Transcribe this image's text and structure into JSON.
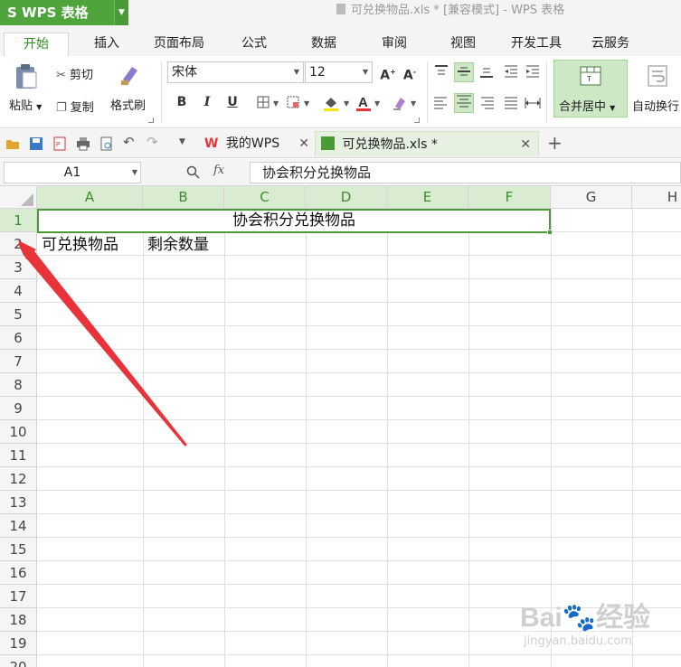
{
  "app": {
    "button_label": "WPS 表格",
    "window_title": "可兑换物品.xls * [兼容模式] - WPS 表格"
  },
  "ribbon_tabs": [
    "开始",
    "插入",
    "页面布局",
    "公式",
    "数据",
    "审阅",
    "视图",
    "开发工具",
    "云服务"
  ],
  "ribbon": {
    "paste": "粘贴",
    "cut": "剪切",
    "copy": "复制",
    "format_painter": "格式刷",
    "font_name": "宋体",
    "font_size": "12",
    "merge_center": "合并居中",
    "wrap_text": "自动换行"
  },
  "doc_tabs": [
    {
      "label": "我的WPS",
      "active": false
    },
    {
      "label": "可兑换物品.xls *",
      "active": true
    }
  ],
  "formula_bar": {
    "name_box": "A1",
    "fx": "fx",
    "content": "协会积分兑换物品"
  },
  "columns": [
    "A",
    "B",
    "C",
    "D",
    "E",
    "F",
    "G",
    "H"
  ],
  "rows": [
    "1",
    "2",
    "3",
    "4",
    "5",
    "6",
    "7",
    "8",
    "9",
    "10",
    "11",
    "12",
    "13",
    "14",
    "15",
    "16",
    "17",
    "18",
    "19",
    "20"
  ],
  "cells": {
    "A1_merged": "协会积分兑换物品",
    "A2": "可兑换物品",
    "B2": "剩余数量"
  },
  "watermark": {
    "brand": "Bai",
    "brand_cn": "经验",
    "url": "jingyan.baidu.com"
  },
  "colors": {
    "accent": "#4a9a37",
    "selection_fill": "#d9ecd2",
    "arrow": "#e8333a"
  }
}
